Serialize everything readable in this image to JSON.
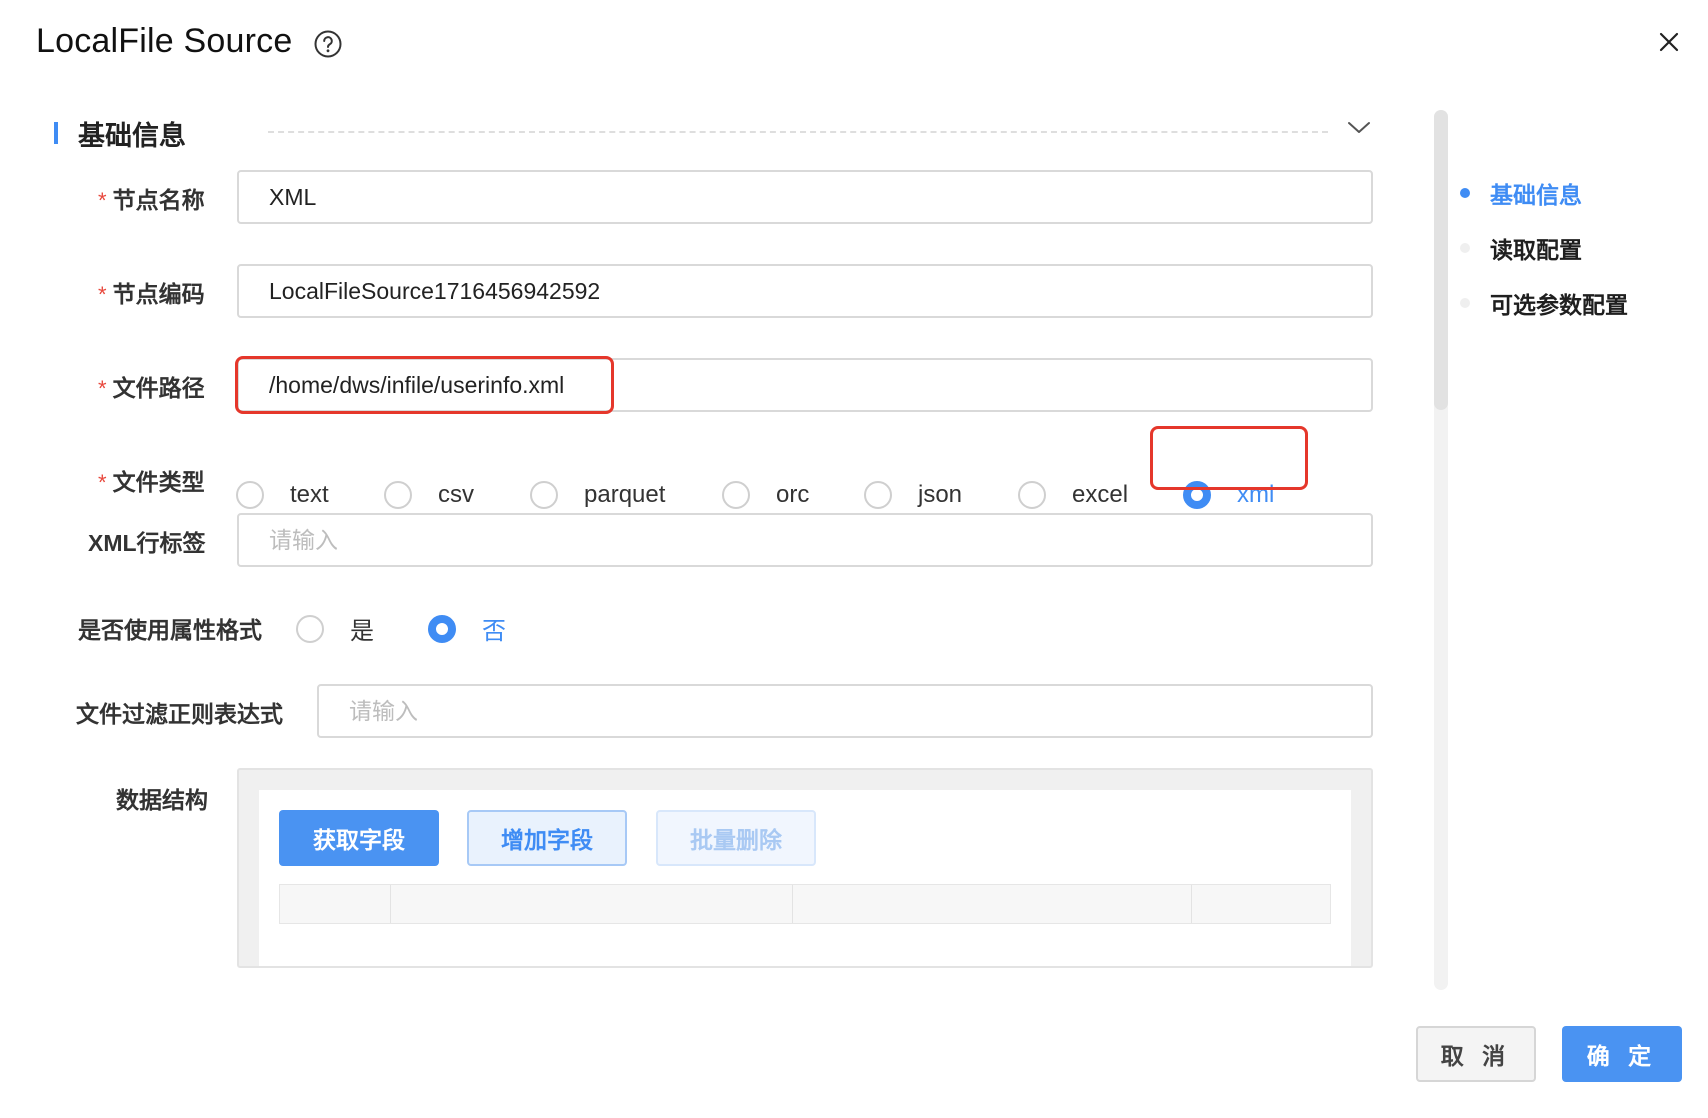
{
  "dialog": {
    "title": "LocalFile Source",
    "help_icon": "question-circle-icon",
    "close_icon": "close-icon"
  },
  "section": {
    "title": "基础信息",
    "collapse_icon": "chevron-down-icon"
  },
  "form": {
    "node_name": {
      "label": "节点名称",
      "required": "*",
      "value": "XML"
    },
    "node_code": {
      "label": "节点编码",
      "required": "*",
      "value": "LocalFileSource1716456942592"
    },
    "file_path": {
      "label": "文件路径",
      "required": "*",
      "value": "/home/dws/infile/userinfo.xml"
    },
    "file_type": {
      "label": "文件类型",
      "required": "*",
      "options": [
        "text",
        "csv",
        "parquet",
        "orc",
        "json",
        "excel",
        "xml"
      ],
      "selected": "xml"
    },
    "xml_row_tag": {
      "label": "XML行标签",
      "placeholder": "请输入",
      "value": ""
    },
    "use_attr_format": {
      "label": "是否使用属性格式",
      "options": [
        "是",
        "否"
      ],
      "selected": "否"
    },
    "file_filter_regex": {
      "label": "文件过滤正则表达式",
      "placeholder": "请输入",
      "value": ""
    },
    "data_structure": {
      "label": "数据结构",
      "buttons": {
        "fetch": "获取字段",
        "add": "增加字段",
        "batch_delete": "批量删除"
      }
    }
  },
  "anchor_nav": {
    "items": [
      "基础信息",
      "读取配置",
      "可选参数配置"
    ],
    "active": "基础信息"
  },
  "footer": {
    "cancel": "取 消",
    "ok": "确 定"
  },
  "colors": {
    "accent": "#3f8cf4",
    "required": "#e8483d",
    "highlight": "#e5372b"
  }
}
